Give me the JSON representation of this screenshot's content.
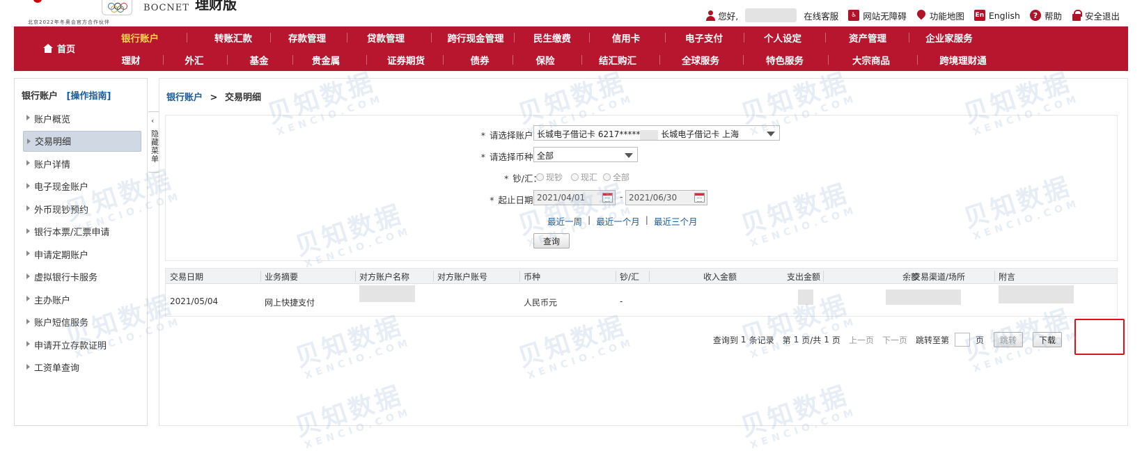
{
  "header": {
    "brand_en": "BOCNET",
    "app_title": "理财版",
    "partner_text": "北京2022年冬奥会官方合作伙伴",
    "greeting": "您好,",
    "links": [
      {
        "label": "在线客服",
        "icon": "support-icon"
      },
      {
        "label": "网站无障碍",
        "icon": "accessibility-icon"
      },
      {
        "label": "功能地图",
        "icon": "map-pin-icon"
      },
      {
        "label": "English",
        "icon": "english-icon"
      },
      {
        "label": "帮助",
        "icon": "help-icon"
      },
      {
        "label": "安全退出",
        "icon": "lock-icon"
      }
    ],
    "english_icon_text": "En",
    "help_icon_text": "?"
  },
  "nav": {
    "home": "首页",
    "row1": [
      "银行账户",
      "转账汇款",
      "存款管理",
      "贷款管理",
      "跨行现金管理",
      "民生缴费",
      "信用卡",
      "电子支付",
      "个人设定",
      "资产管理",
      "企业家服务"
    ],
    "row2": [
      "理财",
      "外汇",
      "基金",
      "贵金属",
      "证券期货",
      "债券",
      "保险",
      "结汇购汇",
      "全球服务",
      "特色服务",
      "大宗商品",
      "跨境理财通"
    ],
    "active": "银行账户"
  },
  "sidebar": {
    "title": "银行账户",
    "guide": "[操作指南]",
    "items": [
      "账户概览",
      "交易明细",
      "账户详情",
      "电子现金账户",
      "外币现钞预约",
      "银行本票/汇票申请",
      "申请定期账户",
      "虚拟银行卡服务",
      "主办账户",
      "账户短信服务",
      "申请开立存款证明",
      "工资单查询"
    ],
    "active_index": 1,
    "collapse_label": "隐藏菜单",
    "collapse_arrow": "‹"
  },
  "breadcrumb": {
    "parent": "银行账户",
    "separator": ">",
    "current": "交易明细"
  },
  "form": {
    "account_label": "请选择账户：",
    "account_value_prefix": "长城电子借记卡  6217*****",
    "account_value_suffix": "长城电子借记卡  上海",
    "currency_label": "请选择币种：",
    "currency_value": "全部",
    "cash_label": "钞/汇：",
    "cash_options": [
      "现钞",
      "现汇",
      "全部"
    ],
    "date_label": "起止日期：",
    "start_date": "2021/04/01",
    "end_date": "2021/06/30",
    "date_dash": "-",
    "quick_ranges": [
      "最近一周",
      "最近一个月",
      "最近三个月"
    ],
    "quick_sep": "|",
    "required_mark": "*",
    "query_button": "查询"
  },
  "table": {
    "columns": [
      "交易日期",
      "业务摘要",
      "对方账户名称",
      "对方账户账号",
      "币种",
      "钞/汇",
      "收入金额",
      "支出金额",
      "余额",
      "交易渠道/场所",
      "附言"
    ],
    "rows": [
      {
        "date": "2021/05/04",
        "summary": "网上快捷支付",
        "counterparty_name": "",
        "counterparty_account": "",
        "currency": "人民币元",
        "cash_flag": "-",
        "income": "",
        "expense": "",
        "balance": "",
        "channel": "",
        "note": ""
      }
    ]
  },
  "pager": {
    "summary_prefix": "查询到",
    "record_count": "1",
    "summary_suffix": "条记录",
    "page_prefix": "第",
    "current_page": "1",
    "page_mid": "页/共",
    "total_pages": "1",
    "page_suffix": "页",
    "prev": "上一页",
    "next": "下一页",
    "jump_label": "跳转至第",
    "jump_unit": "页",
    "go_button": "跳转",
    "download_button": "下载"
  },
  "watermark": {
    "cn": "贝知数据",
    "en": "XENCIO.COM"
  },
  "colors": {
    "brand_red": "#b8162f",
    "active_nav": "#ffd54a",
    "link_blue": "#1a5b9c",
    "highlight_red": "#e0101b"
  }
}
